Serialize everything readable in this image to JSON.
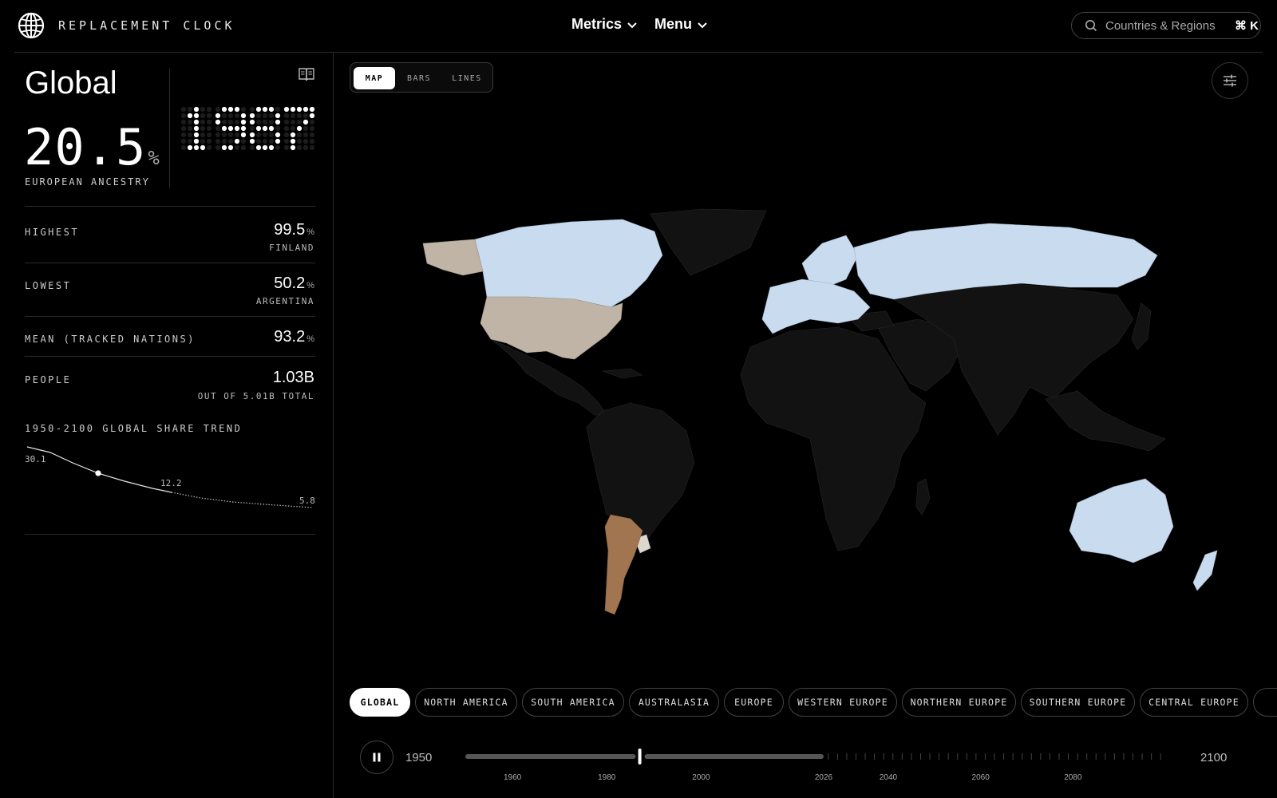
{
  "app": {
    "title": "REPLACEMENT CLOCK"
  },
  "nav": {
    "metrics": "Metrics",
    "menu": "Menu"
  },
  "search": {
    "placeholder": "Countries & Regions",
    "shortcut": "⌘ K"
  },
  "summary": {
    "region": "Global",
    "value": "20.5",
    "unit": "%",
    "metric_label": "EUROPEAN ANCESTRY",
    "year": "1987"
  },
  "stats": [
    {
      "label": "HIGHEST",
      "value": "99.5",
      "unit": "%",
      "sub": "FINLAND"
    },
    {
      "label": "LOWEST",
      "value": "50.2",
      "unit": "%",
      "sub": "ARGENTINA"
    },
    {
      "label": "MEAN (TRACKED NATIONS)",
      "value": "93.2",
      "unit": "%",
      "sub": ""
    },
    {
      "label": "PEOPLE",
      "value": "1.03B",
      "unit": "",
      "sub": "OUT OF 5.01B TOTAL"
    }
  ],
  "trend": {
    "title": "1950-2100 GLOBAL SHARE TREND",
    "labels": {
      "start": "30.1",
      "mid": "12.2",
      "end": "5.8"
    }
  },
  "view_toggle": {
    "options": [
      "MAP",
      "BARS",
      "LINES"
    ],
    "active": "MAP"
  },
  "regions": {
    "items": [
      "GLOBAL",
      "NORTH AMERICA",
      "SOUTH AMERICA",
      "AUSTRALASIA",
      "EUROPE",
      "WESTERN EUROPE",
      "NORTHERN EUROPE",
      "SOUTHERN EUROPE",
      "CENTRAL EUROPE"
    ],
    "active": "GLOBAL"
  },
  "timeline": {
    "start": "1950",
    "end": "2100",
    "current_year": 1987,
    "present_year": 2026,
    "ticks": [
      "1960",
      "1980",
      "2000",
      "2026",
      "2040",
      "2060",
      "2080"
    ]
  },
  "colors": {
    "high": "#c9dcef",
    "mid": "#bfb4a6",
    "low": "#a27551",
    "no_data": "#121212",
    "accent": "#ffffff"
  }
}
